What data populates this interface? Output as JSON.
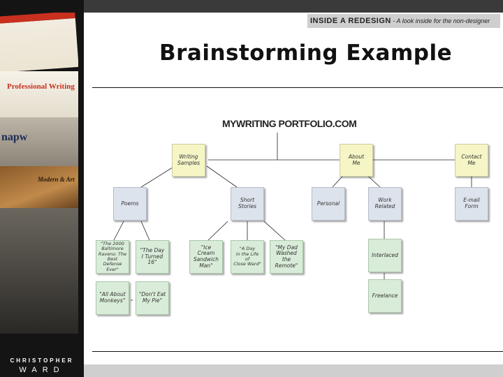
{
  "banner": {
    "tagline_bold": "INSIDE A REDESIGN",
    "tagline_rest": " - A look inside for the non-designer"
  },
  "slide": {
    "title": "Brainstorming Example"
  },
  "brand": {
    "top": "CHRISTOPHER",
    "bottom": "WARD"
  },
  "collage": {
    "text1": "Professional Writing",
    "text2": "napw",
    "text3": "Modern & Art"
  },
  "diagram": {
    "title": "MYWRITING PORTFOLIO.COM",
    "nodes": {
      "writing_samples": "Writing\nSamples",
      "about_me": "About\nMe",
      "contact_me": "Contact\nMe",
      "poems": "Poems",
      "short_stories": "Short\nStories",
      "personal": "Personal",
      "work_related": "Work\nRelated",
      "email_form": "E-mail\nForm",
      "poem_1": "\"The 2000\nBaltimore\nRavens: The\nBest Defense\nEver\"",
      "poem_2": "\"The Day\nI Turned\n16\"",
      "story_1": "\"Ice\nCream\nSandwich\nMan\"",
      "story_2": "\"A Day\nin the Life\nof\nClose Ward\"",
      "story_3": "\"My Dad\nWashed\nthe Remote\"",
      "interlaced": "Interlaced",
      "freelance": "Freelance",
      "poem_3": "\"All About\nMonkeys\"",
      "poem_4": "\"Don't Eat\nMy Pie\""
    }
  },
  "colors": {
    "level1_yellow": "#f6f5c6",
    "level2_blue": "#dde3ec",
    "level3_green": "#d9ecd9"
  }
}
